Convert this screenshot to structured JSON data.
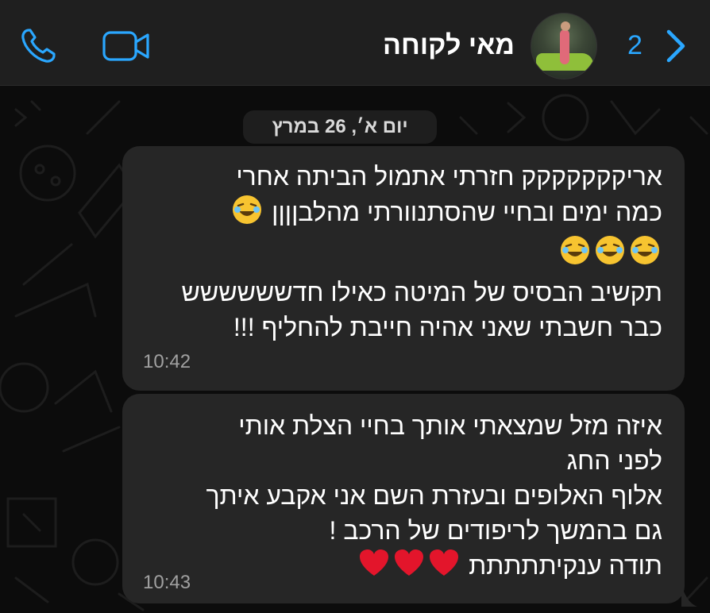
{
  "header": {
    "contact_name": "מאי לקוחה",
    "back_count": "2",
    "icons": {
      "call": "phone-icon",
      "video": "video-camera-icon",
      "back": "chevron-right-icon",
      "avatar": "contact-avatar"
    },
    "accent_color": "#2aa7ff"
  },
  "chat": {
    "date_label": "יום א׳, 26 במרץ",
    "messages": [
      {
        "lines": [
          "אריקקקקקקק חזרתי אתמול הביתה אחרי",
          "כמה ימים ובחיי שהסתנוורתי מהלבןןןן",
          "",
          "תקשיב הבסיס של המיטה כאילו חדשששששש",
          "כבר חשבתי שאני אהיה חייבת להחליף !!!"
        ],
        "emojis": "rolling-on-floor-laughing x4",
        "time": "10:42"
      },
      {
        "lines": [
          "איזה מזל שמצאתי אותך בחיי הצלת אותי",
          "לפני החג",
          "אלוף האלופים ובעזרת השם אני אקבע איתך",
          "גם בהמשך לריפודים של הרכב !",
          "תודה ענקיתתתתת"
        ],
        "emojis": "red-heart x3",
        "time": "10:43"
      }
    ]
  }
}
